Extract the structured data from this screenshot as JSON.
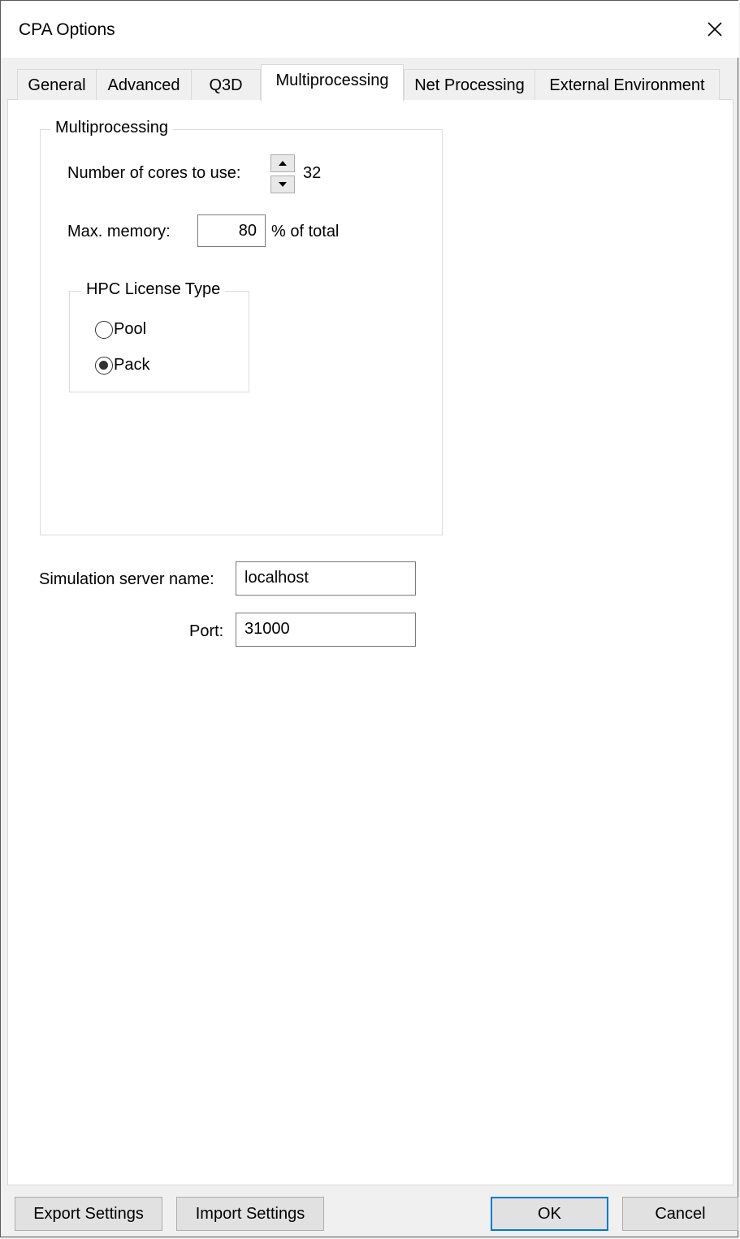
{
  "window": {
    "title": "CPA Options"
  },
  "tabs": [
    {
      "label": "General",
      "active": false
    },
    {
      "label": "Advanced",
      "active": false
    },
    {
      "label": "Q3D",
      "active": false
    },
    {
      "label": "Multiprocessing",
      "active": true
    },
    {
      "label": "Net Processing",
      "active": false
    },
    {
      "label": "External Environment",
      "active": false
    }
  ],
  "multiprocessing": {
    "group_label": "Multiprocessing",
    "cores_label": "Number of cores to use:",
    "cores_value": "32",
    "memory_label": "Max. memory:",
    "memory_value": "80",
    "memory_suffix": "% of total",
    "license": {
      "group_label": "HPC License Type",
      "options": [
        {
          "label": "Pool",
          "selected": false
        },
        {
          "label": "Pack",
          "selected": true
        }
      ]
    }
  },
  "server": {
    "name_label": "Simulation server name:",
    "name_value": "localhost",
    "port_label": "Port:",
    "port_value": "31000"
  },
  "buttons": {
    "export": "Export Settings",
    "import": "Import Settings",
    "ok": "OK",
    "cancel": "Cancel"
  },
  "colors": {
    "focus_border": "#0078d7"
  }
}
